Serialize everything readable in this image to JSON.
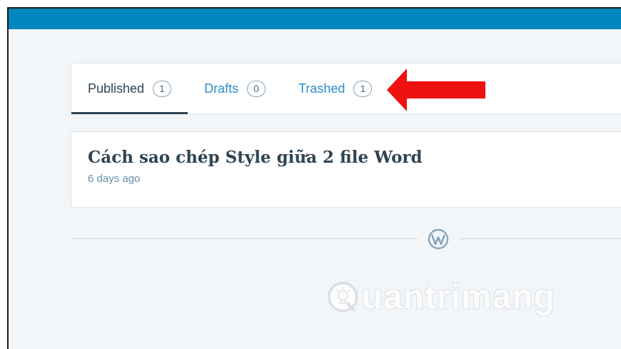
{
  "tabs": [
    {
      "label": "Published",
      "count": "1",
      "active": true
    },
    {
      "label": "Drafts",
      "count": "0",
      "active": false
    },
    {
      "label": "Trashed",
      "count": "1",
      "active": false
    }
  ],
  "post": {
    "title": "Cách sao chép Style giữa 2 file Word",
    "date": "6 days ago"
  },
  "watermark": {
    "text": "uantrimang"
  },
  "colors": {
    "topbar": "#0087be",
    "background": "#f3f6f8",
    "tab_link": "#2e8dcf",
    "tab_active": "#2e4453",
    "arrow": "#ee1111"
  },
  "icons": {
    "brand": "wordpress-icon",
    "annotation": "red-arrow-icon",
    "watermark": "lightbulb-icon"
  }
}
